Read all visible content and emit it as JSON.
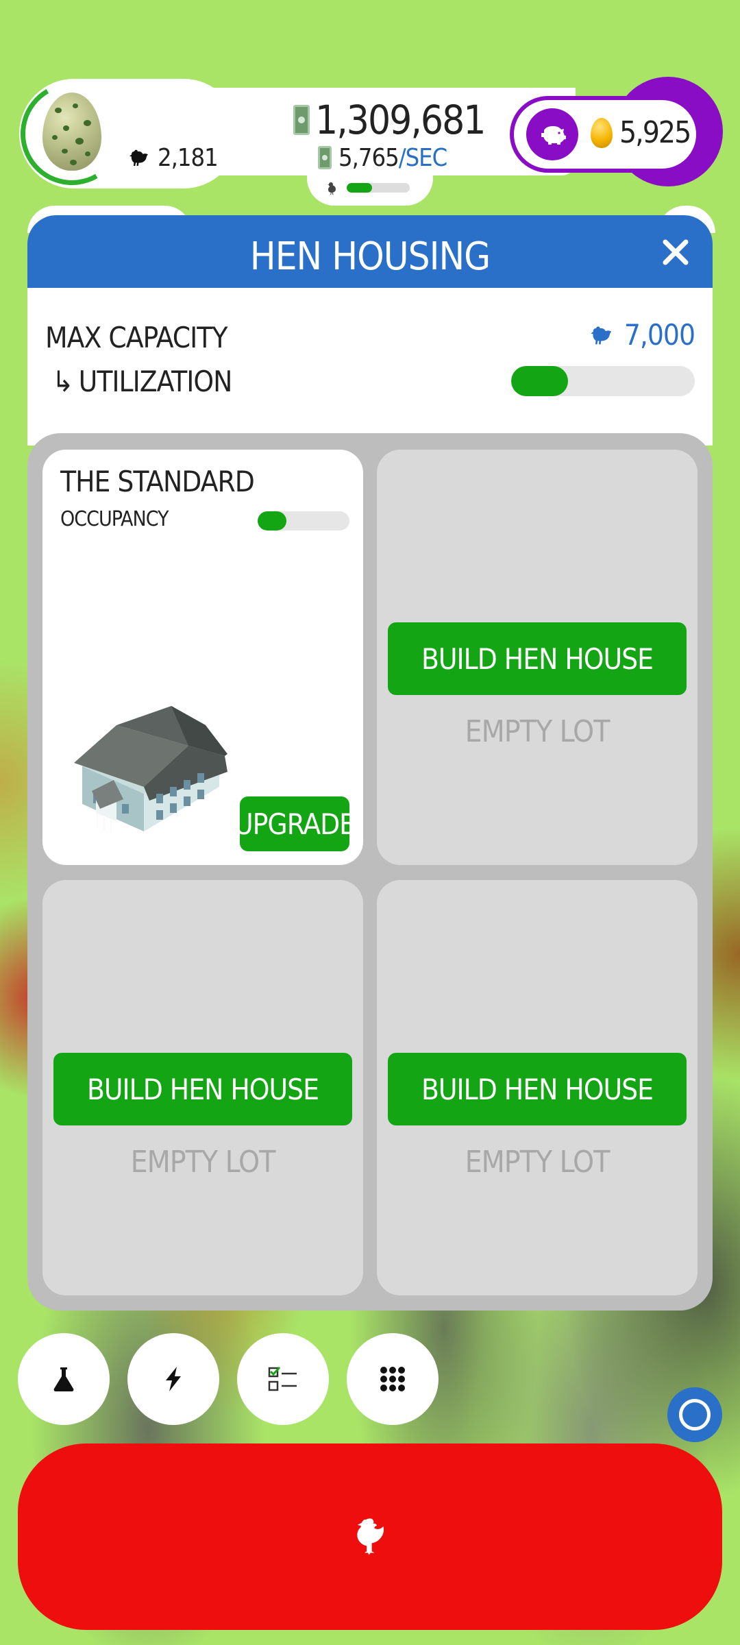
{
  "hud": {
    "chicken_count": "2,181",
    "money": "1,309,681",
    "rate_value": "5,765",
    "rate_unit": "/SEC",
    "habitat_fill": 0.4,
    "golden_eggs": "5,925"
  },
  "modal": {
    "title": "HEN HOUSING",
    "max_capacity_label": "MAX CAPACITY",
    "max_capacity_value": "7,000",
    "utilization_label": "UTILIZATION",
    "utilization_arrow": "↳",
    "utilization_fill": 0.31
  },
  "lots": [
    {
      "state": "built",
      "name": "THE STANDARD",
      "occupancy_label": "OCCUPANCY",
      "occupancy_fill": 0.31,
      "upgrade_label": "UPGRADE"
    },
    {
      "state": "empty",
      "build_label": "BUILD HEN HOUSE",
      "empty_label": "EMPTY LOT"
    },
    {
      "state": "empty",
      "build_label": "BUILD HEN HOUSE",
      "empty_label": "EMPTY LOT"
    },
    {
      "state": "empty",
      "build_label": "BUILD HEN HOUSE",
      "empty_label": "EMPTY LOT"
    }
  ],
  "toolbar": {
    "buttons": [
      "research-icon",
      "boost-icon",
      "missions-icon",
      "menu-grid-icon"
    ]
  },
  "colors": {
    "background": "#a9e467",
    "header_blue": "#2a70c8",
    "build_green": "#14a514",
    "premium_purple": "#8a0dc6",
    "hatch_red": "#ee0e0e"
  }
}
